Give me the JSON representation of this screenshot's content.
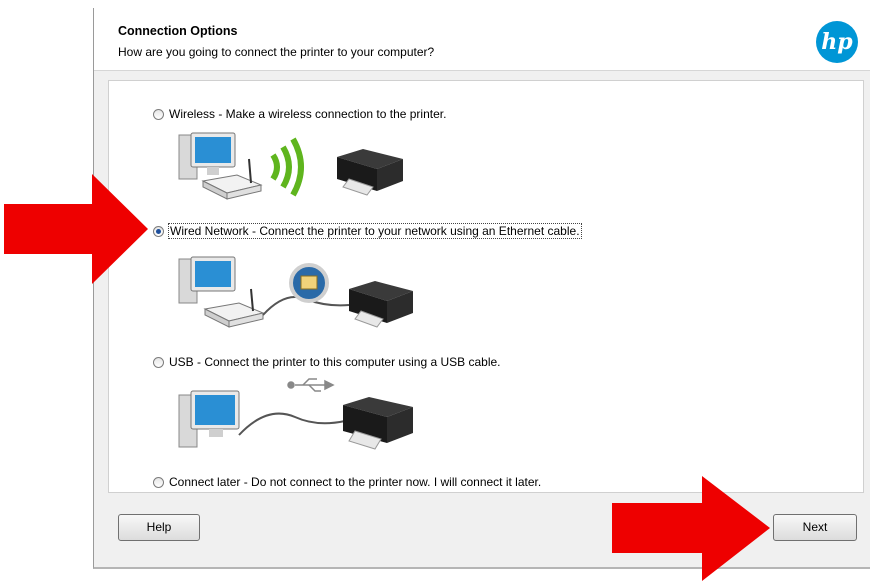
{
  "dialog": {
    "title": "Connection Options",
    "subtitle": "How are you going to connect the printer to your computer?",
    "logo_text": "hp"
  },
  "options": [
    {
      "id": "wireless",
      "label": "Wireless - Make a wireless connection to the printer.",
      "selected": false
    },
    {
      "id": "wired",
      "label": "Wired Network - Connect the printer to your network using an Ethernet cable.",
      "selected": true
    },
    {
      "id": "usb",
      "label": "USB - Connect the printer to this computer using a USB cable.",
      "selected": false
    },
    {
      "id": "later",
      "label": "Connect later - Do not connect to the printer now. I will connect it later.",
      "selected": false
    }
  ],
  "buttons": {
    "help": "Help",
    "next": "Next"
  },
  "colors": {
    "hp_blue": "#0096d6",
    "arrow_red": "#ee0000",
    "wifi_green": "#5fb51e"
  }
}
